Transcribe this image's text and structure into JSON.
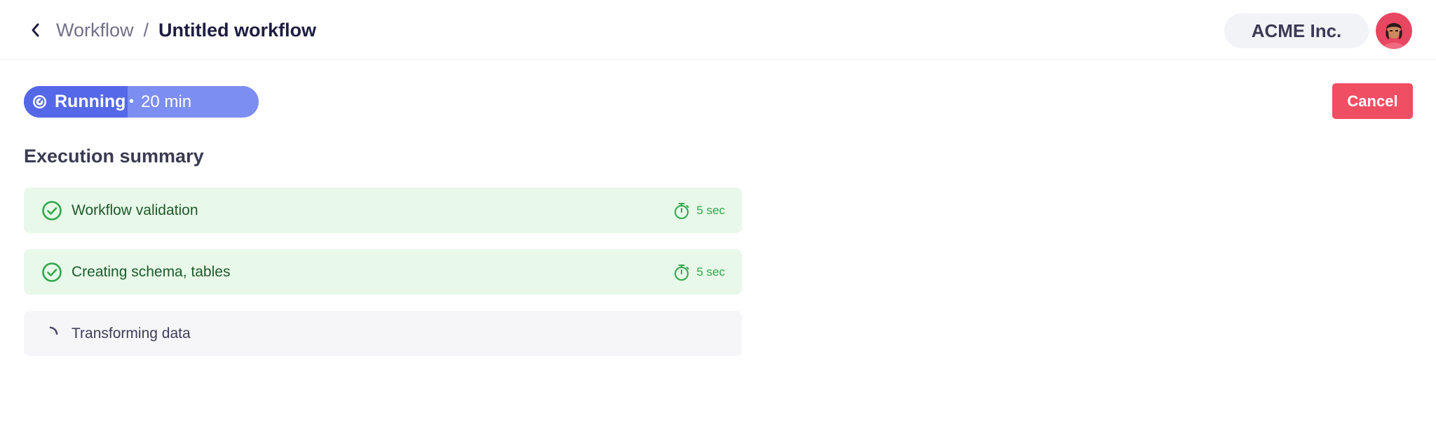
{
  "header": {
    "breadcrumb_parent": "Workflow",
    "breadcrumb_separator": "/",
    "breadcrumb_current": "Untitled workflow",
    "org_name": "ACME Inc."
  },
  "status": {
    "label": "Running",
    "separator": "•",
    "duration": "20 min"
  },
  "actions": {
    "cancel_label": "Cancel"
  },
  "summary": {
    "title": "Execution summary",
    "steps": [
      {
        "label": "Workflow validation",
        "state": "done",
        "time": "5 sec"
      },
      {
        "label": "Creating schema, tables",
        "state": "done",
        "time": "5 sec"
      },
      {
        "label": "Transforming data",
        "state": "running",
        "time": ""
      }
    ]
  },
  "colors": {
    "accent": "#5468e8",
    "accent_light": "#7c8ef2",
    "danger": "#f04e63",
    "success": "#2fa84b",
    "success_bg": "#e8f8e9"
  },
  "icons": {
    "back": "chevron-left-icon",
    "status": "gauge-icon",
    "done": "check-circle-icon",
    "timer": "stopwatch-icon",
    "running": "spinner-icon"
  }
}
